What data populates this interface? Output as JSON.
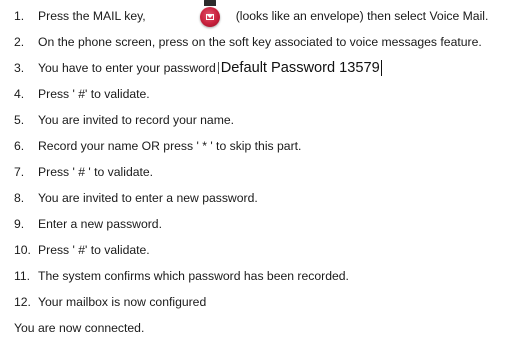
{
  "steps": [
    {
      "num": "1.",
      "text": "Press the MAIL key,",
      "after_icon": "(looks like an envelope) then select Voice Mail."
    },
    {
      "num": "2.",
      "text": "On the phone screen, press on the soft key associated to voice messages feature."
    },
    {
      "num": "3.",
      "text": "You have to enter your password",
      "note": "Default Password 13579"
    },
    {
      "num": "4.",
      "text": "Press ' #' to validate."
    },
    {
      "num": "5.",
      "text": "You are invited to record your name."
    },
    {
      "num": "6.",
      "text": "Record your name OR press ' * ' to skip this part."
    },
    {
      "num": "7.",
      "text": "Press ' # ' to validate."
    },
    {
      "num": "8.",
      "text": "You are invited to enter a new password."
    },
    {
      "num": "9.",
      "text": "Enter a new password."
    },
    {
      "num": "10.",
      "text": "Press ' #' to validate."
    },
    {
      "num": "11.",
      "text": "The system confirms which password has been recorded."
    },
    {
      "num": "12.",
      "text": "Your mailbox is now configured"
    }
  ],
  "footer": "You are now connected.",
  "icons": {
    "mail_key": "mail-key-icon"
  },
  "colors": {
    "mail_key": "#c8203c",
    "text": "#1a1a1a"
  }
}
